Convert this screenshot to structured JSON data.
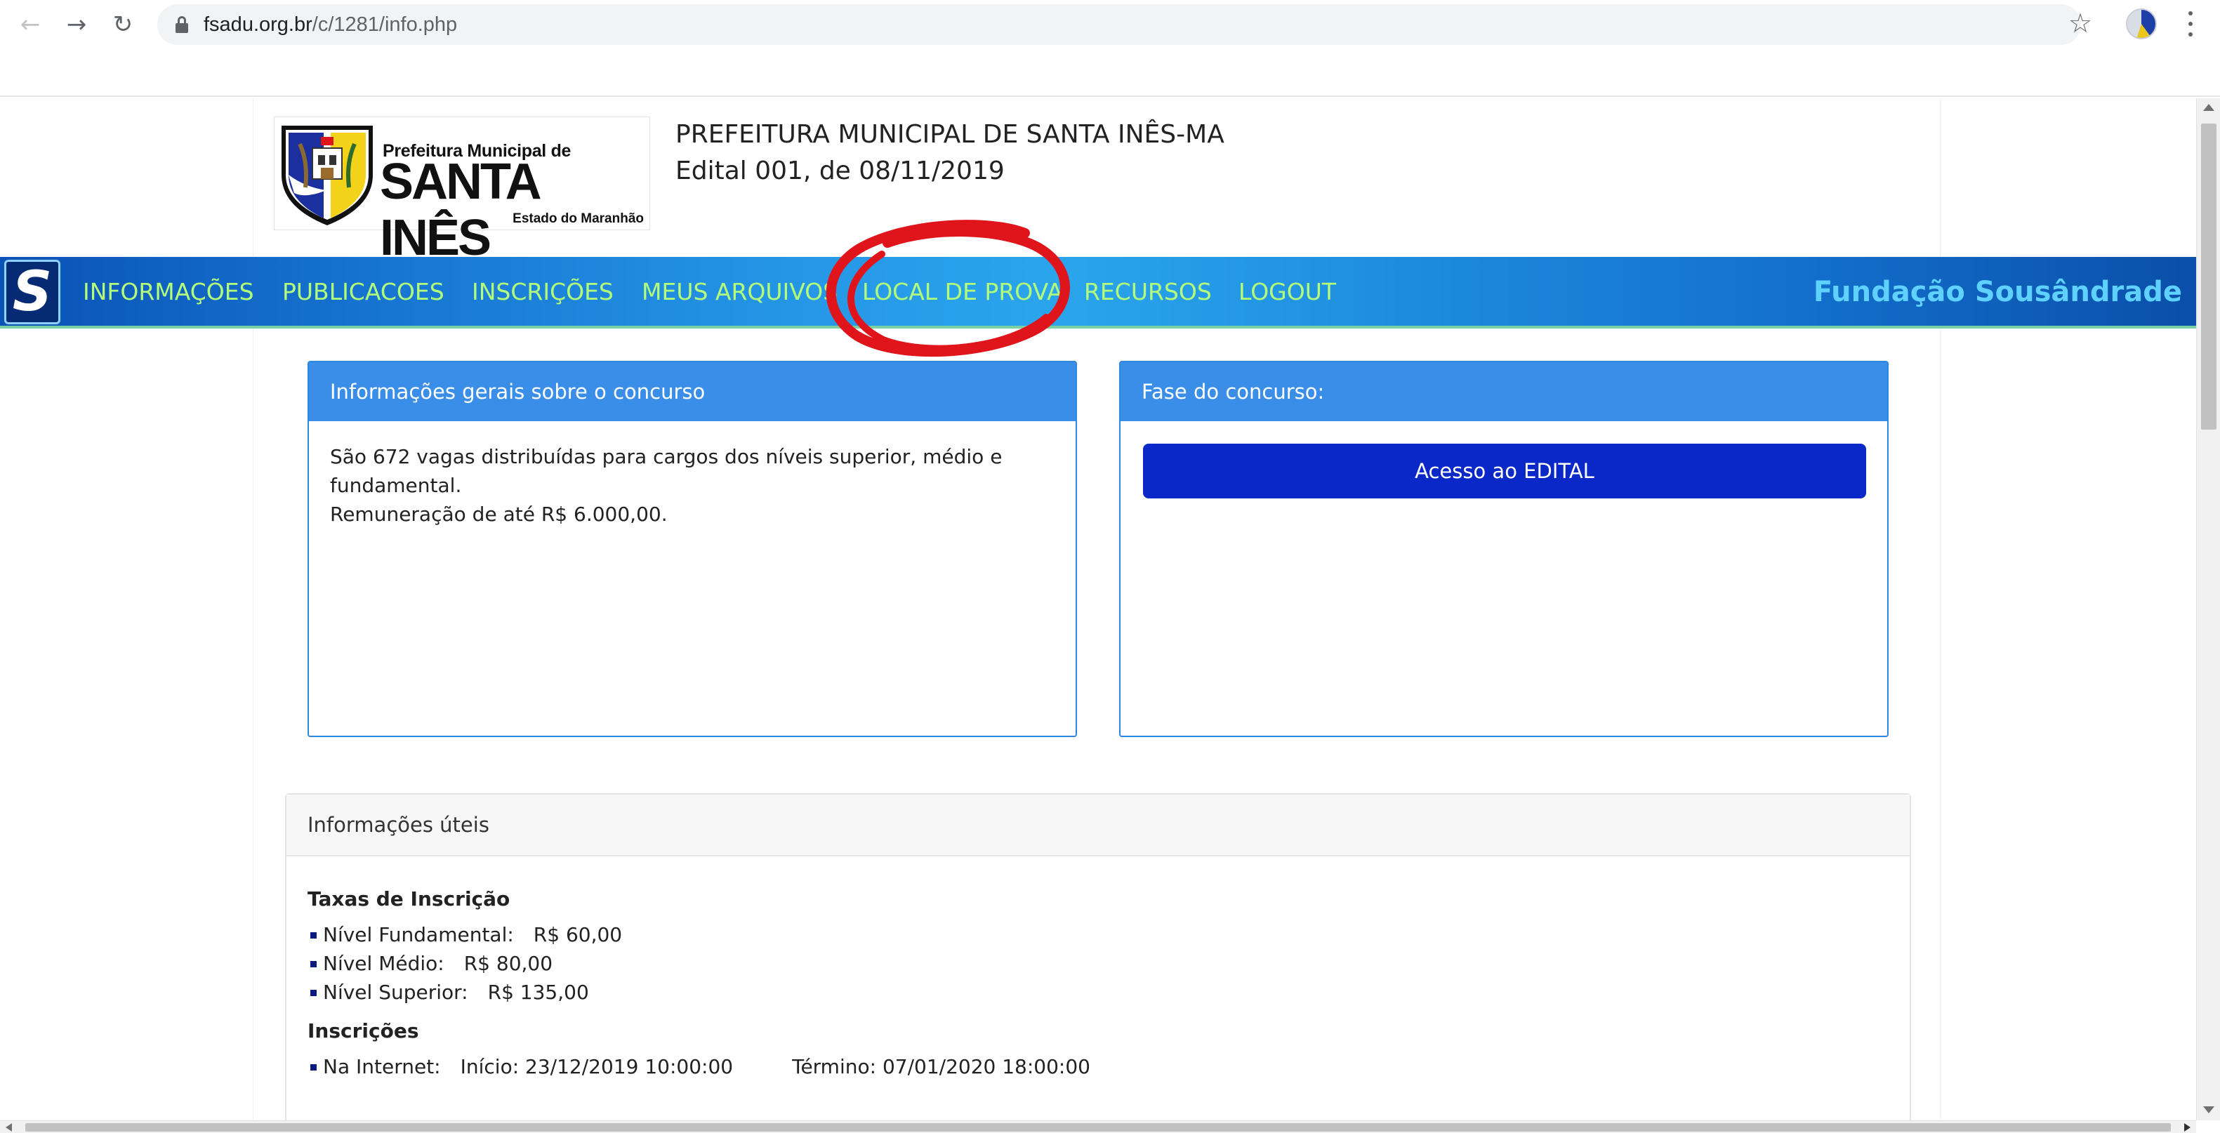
{
  "browser": {
    "url_host": "fsadu.org.br",
    "url_path": "/c/1281/info.php",
    "back_icon": "arrow-left-icon",
    "forward_icon": "arrow-right-icon",
    "reload_icon": "reload-icon",
    "bookmark_icon": "star-icon",
    "profile_icon": "avatar-icon",
    "menu_icon": "kebab-menu-icon"
  },
  "header": {
    "logo": {
      "small_text": "Prefeitura Municipal de",
      "big_text": "SANTA INÊS",
      "state_text": "Estado do Maranhão"
    },
    "title": "PREFEITURA MUNICIPAL DE SANTA INÊS-MA",
    "subtitle": "Edital 001, de 08/11/2019"
  },
  "nav": {
    "logo_letter": "S",
    "items": [
      {
        "label": "INFORMAÇÕES"
      },
      {
        "label": "PUBLICACOES"
      },
      {
        "label": "INSCRIÇÕES"
      },
      {
        "label": "MEUS ARQUIVOS"
      },
      {
        "label": "LOCAL DE PROVA"
      },
      {
        "label": "RECURSOS"
      },
      {
        "label": "LOGOUT"
      }
    ],
    "brand": "Fundação Sousândrade"
  },
  "cards": {
    "general": {
      "title": "Informações gerais sobre o concurso",
      "line1": "São 672 vagas distribuídas para cargos dos níveis superior, médio e fundamental.",
      "line2": "Remuneração de até R$ 6.000,00."
    },
    "phase": {
      "title": "Fase do concurso:",
      "button": "Acesso ao EDITAL"
    }
  },
  "useful": {
    "title": "Informações úteis",
    "fees_title": "Taxas de Inscrição",
    "fees": [
      {
        "level": "Nível Fundamental:",
        "value": "R$ 60,00"
      },
      {
        "level": "Nível Médio:",
        "value": "R$ 80,00"
      },
      {
        "level": "Nível Superior:",
        "value": "R$ 135,00"
      }
    ],
    "inscriptions_title": "Inscrições",
    "internet": {
      "label": "Na Internet:",
      "start": "Início: 23/12/2019 10:00:00",
      "end": "Término: 07/01/2020 18:00:00"
    }
  },
  "colors": {
    "nav_text": "#b3ff7a",
    "nav_brand": "#5fd1ff",
    "card_header": "#3a8ee8",
    "edital_button": "#0a28c8",
    "annotation": "#e0141b"
  }
}
